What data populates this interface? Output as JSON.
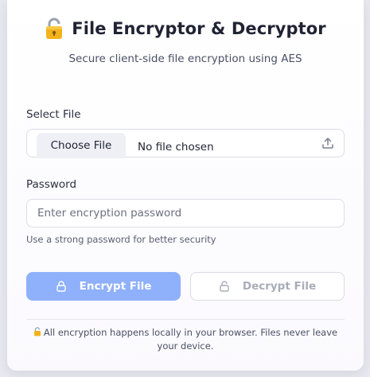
{
  "header": {
    "title": "File Encryptor & Decryptor",
    "subtitle": "Secure client-side file encryption using AES",
    "icon": "padlock-icon"
  },
  "file": {
    "label": "Select File",
    "choose_label": "Choose File",
    "status": "No file chosen",
    "icon": "upload-icon"
  },
  "password": {
    "label": "Password",
    "placeholder": "Enter encryption password",
    "value": "",
    "hint": "Use a strong password for better security"
  },
  "actions": {
    "encrypt_label": "Encrypt File",
    "decrypt_label": "Decrypt File",
    "encrypt_icon": "lock-icon",
    "decrypt_icon": "lock-icon"
  },
  "footer": {
    "icon": "padlock-icon",
    "text": "All encryption happens locally in your browser. Files never leave your device."
  },
  "colors": {
    "accent": "#8fb0fb",
    "title": "#1f2333",
    "muted": "#4a5064"
  }
}
